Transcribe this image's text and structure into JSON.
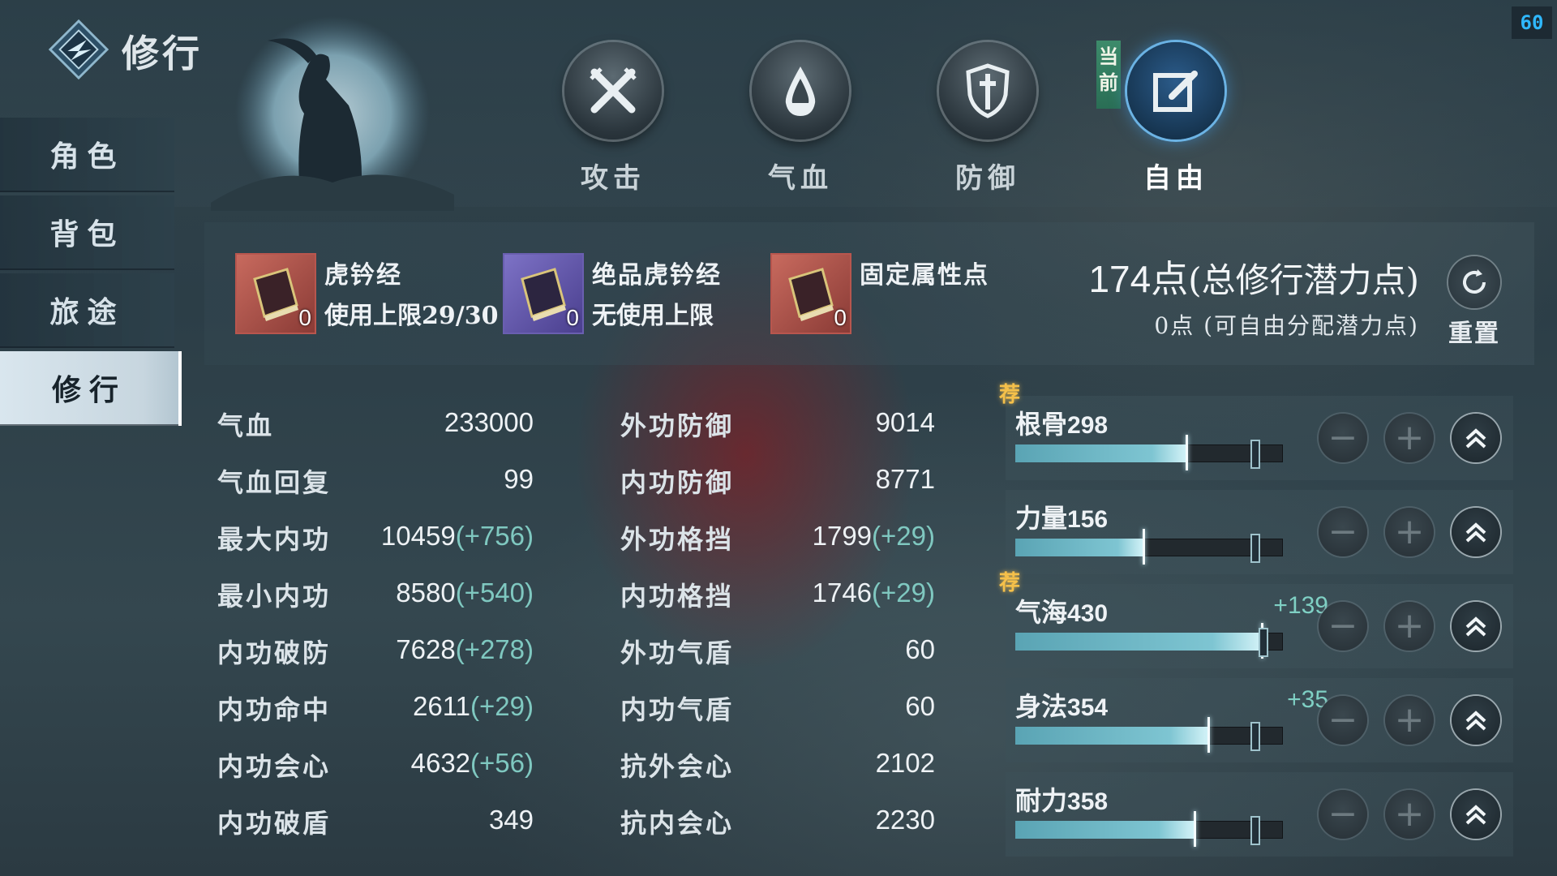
{
  "fps": "60",
  "header": {
    "title": "修行"
  },
  "sidebar": {
    "items": [
      {
        "label": "角色",
        "active": false
      },
      {
        "label": "背包",
        "active": false
      },
      {
        "label": "旅途",
        "active": false
      },
      {
        "label": "修行",
        "active": true
      }
    ]
  },
  "tabs": [
    {
      "label": "攻击",
      "icon": "crossed-swords-icon"
    },
    {
      "label": "气血",
      "icon": "blood-drop-icon"
    },
    {
      "label": "防御",
      "icon": "shield-icon"
    },
    {
      "label": "自由",
      "icon": "edit-icon",
      "current": true
    }
  ],
  "current_badge": "当前",
  "items": [
    {
      "name": "虎钤经",
      "limit": "使用上限29/30",
      "count": "0",
      "frame_color": "#b8564e"
    },
    {
      "name": "绝品虎钤经",
      "limit": "无使用上限",
      "count": "0",
      "frame_color": "#6a5fb0"
    },
    {
      "name": "固定属性点",
      "limit": "",
      "count": "0",
      "frame_color": "#b8564e"
    }
  ],
  "points": {
    "total_value": "174点",
    "total_label": "(总修行潜力点)",
    "free_text": "0点 (可自由分配潜力点)"
  },
  "reset_label": "重置",
  "stats_left": [
    {
      "name": "气血",
      "value": "233000",
      "bonus": ""
    },
    {
      "name": "气血回复",
      "value": "99",
      "bonus": ""
    },
    {
      "name": "最大内功",
      "value": "10459",
      "bonus": "(+756)"
    },
    {
      "name": "最小内功",
      "value": "8580",
      "bonus": "(+540)"
    },
    {
      "name": "内功破防",
      "value": "7628",
      "bonus": "(+278)"
    },
    {
      "name": "内功命中",
      "value": "2611",
      "bonus": "(+29)"
    },
    {
      "name": "内功会心",
      "value": "4632",
      "bonus": "(+56)"
    },
    {
      "name": "内功破盾",
      "value": "349",
      "bonus": ""
    }
  ],
  "stats_right": [
    {
      "name": "外功防御",
      "value": "9014",
      "bonus": ""
    },
    {
      "name": "内功防御",
      "value": "8771",
      "bonus": ""
    },
    {
      "name": "外功格挡",
      "value": "1799",
      "bonus": "(+29)"
    },
    {
      "name": "内功格挡",
      "value": "1746",
      "bonus": "(+29)"
    },
    {
      "name": "外功气盾",
      "value": "60",
      "bonus": ""
    },
    {
      "name": "内功气盾",
      "value": "60",
      "bonus": ""
    },
    {
      "name": "抗外会心",
      "value": "2102",
      "bonus": ""
    },
    {
      "name": "抗内会心",
      "value": "2230",
      "bonus": ""
    }
  ],
  "recommend_label": "荐",
  "attributes": [
    {
      "name": "根骨",
      "value": "298",
      "bonus": "",
      "recommended": true,
      "fill": 0.64,
      "marker": 0.89
    },
    {
      "name": "力量",
      "value": "156",
      "bonus": "",
      "recommended": false,
      "fill": 0.48,
      "marker": 0.89
    },
    {
      "name": "气海",
      "value": "430",
      "bonus": "+139",
      "recommended": true,
      "fill": 0.92,
      "marker": 0.92
    },
    {
      "name": "身法",
      "value": "354",
      "bonus": "+35",
      "recommended": false,
      "fill": 0.72,
      "marker": 0.89
    },
    {
      "name": "耐力",
      "value": "358",
      "bonus": "",
      "recommended": false,
      "fill": 0.67,
      "marker": 0.89
    }
  ],
  "buttons": {
    "minus": "−",
    "plus": "+"
  }
}
